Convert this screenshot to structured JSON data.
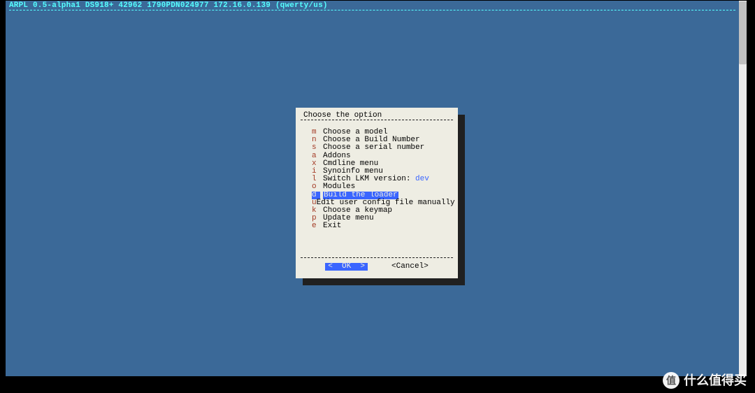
{
  "header": {
    "text": "ARPL 0.5-alpha1 DS918+ 42962 1790PDN024977 172.16.0.139 (qwerty/us)"
  },
  "dialog": {
    "title": "Choose the option",
    "menu": [
      {
        "key": "m",
        "label": "Choose a model",
        "selected": false
      },
      {
        "key": "n",
        "label": "Choose a Build Number",
        "selected": false
      },
      {
        "key": "s",
        "label": "Choose a serial number",
        "selected": false
      },
      {
        "key": "a",
        "label": "Addons",
        "selected": false
      },
      {
        "key": "x",
        "label": "Cmdline menu",
        "selected": false
      },
      {
        "key": "i",
        "label": "Synoinfo menu",
        "selected": false
      },
      {
        "key": "l",
        "label": "Switch LKM version: ",
        "extra": "dev",
        "selected": false
      },
      {
        "key": "o",
        "label": "Modules",
        "selected": false
      },
      {
        "key": "d",
        "label": "Build the loader",
        "selected": true
      },
      {
        "key": "u",
        "label": "Edit user config file manually",
        "selected": false
      },
      {
        "key": "k",
        "label": "Choose a keymap",
        "selected": false
      },
      {
        "key": "p",
        "label": "Update menu",
        "selected": false
      },
      {
        "key": "e",
        "label": "Exit",
        "selected": false
      }
    ],
    "buttons": {
      "ok": "<  OK  >",
      "cancel": "<Cancel>"
    }
  },
  "watermark": {
    "badge": "值",
    "text": "什么值得买"
  }
}
